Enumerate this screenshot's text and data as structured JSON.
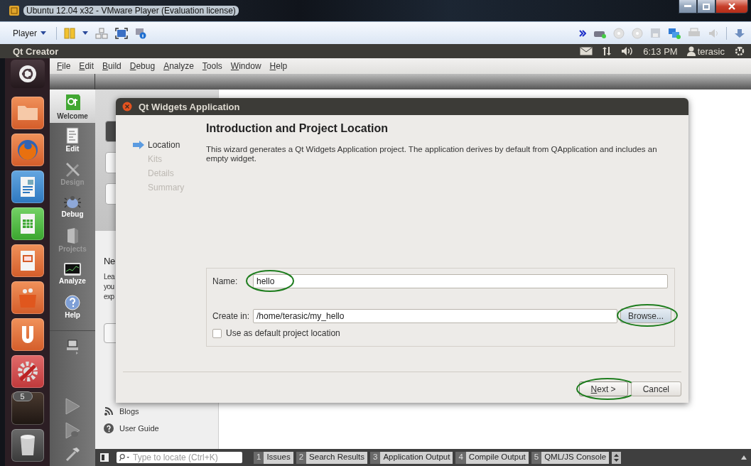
{
  "host_window": {
    "title": "Ubuntu 12.04 x32 - VMware Player (Evaluation license)"
  },
  "player_toolbar": {
    "menu": "Player"
  },
  "top_panel": {
    "app_title": "Qt Creator",
    "clock": "6:13 PM",
    "user": "terasic"
  },
  "menu_bar": [
    "File",
    "Edit",
    "Build",
    "Debug",
    "Analyze",
    "Tools",
    "Window",
    "Help"
  ],
  "launcher": {
    "workspace_badge": "5"
  },
  "modes": [
    {
      "label": "Welcome",
      "kind": "welcome",
      "selected": true,
      "disabled": false
    },
    {
      "label": "Edit",
      "kind": "edit",
      "selected": false,
      "disabled": false
    },
    {
      "label": "Design",
      "kind": "design",
      "selected": false,
      "disabled": true
    },
    {
      "label": "Debug",
      "kind": "debug",
      "selected": false,
      "disabled": false
    },
    {
      "label": "Projects",
      "kind": "projects",
      "selected": false,
      "disabled": true
    },
    {
      "label": "Analyze",
      "kind": "analyze",
      "selected": false,
      "disabled": false
    },
    {
      "label": "Help",
      "kind": "help",
      "selected": false,
      "disabled": false
    }
  ],
  "welcome": {
    "heading": "Ne",
    "text_lines": [
      "Lea",
      "you",
      "exp"
    ],
    "links": [
      {
        "label": "Blogs",
        "kind": "rss"
      },
      {
        "label": "User Guide",
        "kind": "help"
      }
    ]
  },
  "dialog": {
    "title": "Qt Widgets Application",
    "steps": [
      {
        "label": "Location",
        "selected": true
      },
      {
        "label": "Kits",
        "selected": false
      },
      {
        "label": "Details",
        "selected": false
      },
      {
        "label": "Summary",
        "selected": false
      }
    ],
    "heading": "Introduction and Project Location",
    "description": "This wizard generates a Qt Widgets Application project. The application derives by default from QApplication and includes an empty widget.",
    "name_field": {
      "label": "Name:",
      "value": "hello",
      "highlighted": true
    },
    "location_field": {
      "label": "Create in:",
      "value": "/home/terasic/my_hello"
    },
    "browse_button": {
      "label": "Browse...",
      "highlighted": true
    },
    "default_checkbox": {
      "label": "Use as default project location",
      "checked": false
    },
    "buttons": [
      {
        "label": "Next >",
        "kind": "default",
        "highlighted": true
      },
      {
        "label": "Cancel",
        "kind": "normal",
        "highlighted": false
      }
    ]
  },
  "locator": {
    "placeholder": "Type to locate (Ctrl+K)"
  },
  "output_panes": [
    {
      "number": "1",
      "label": "Issues"
    },
    {
      "number": "2",
      "label": "Search Results"
    },
    {
      "number": "3",
      "label": "Application Output"
    },
    {
      "number": "4",
      "label": "Compile Output"
    },
    {
      "number": "5",
      "label": "QML/JS Console"
    }
  ]
}
